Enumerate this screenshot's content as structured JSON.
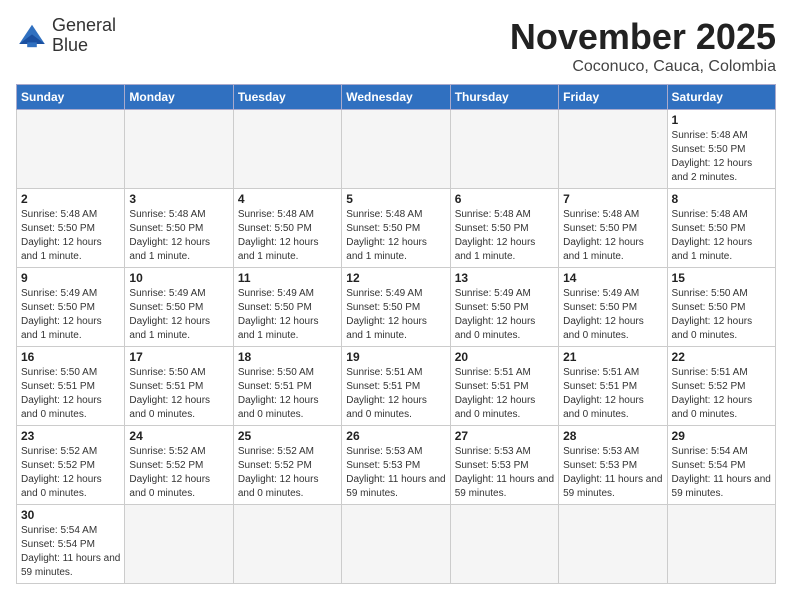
{
  "logo": {
    "line1": "General",
    "line2": "Blue"
  },
  "title": "November 2025",
  "location": "Coconuco, Cauca, Colombia",
  "days_of_week": [
    "Sunday",
    "Monday",
    "Tuesday",
    "Wednesday",
    "Thursday",
    "Friday",
    "Saturday"
  ],
  "weeks": [
    [
      {
        "day": "",
        "info": "",
        "empty": true
      },
      {
        "day": "",
        "info": "",
        "empty": true
      },
      {
        "day": "",
        "info": "",
        "empty": true
      },
      {
        "day": "",
        "info": "",
        "empty": true
      },
      {
        "day": "",
        "info": "",
        "empty": true
      },
      {
        "day": "",
        "info": "",
        "empty": true
      },
      {
        "day": "1",
        "info": "Sunrise: 5:48 AM\nSunset: 5:50 PM\nDaylight: 12 hours\nand 2 minutes."
      }
    ],
    [
      {
        "day": "2",
        "info": "Sunrise: 5:48 AM\nSunset: 5:50 PM\nDaylight: 12 hours\nand 1 minute."
      },
      {
        "day": "3",
        "info": "Sunrise: 5:48 AM\nSunset: 5:50 PM\nDaylight: 12 hours\nand 1 minute."
      },
      {
        "day": "4",
        "info": "Sunrise: 5:48 AM\nSunset: 5:50 PM\nDaylight: 12 hours\nand 1 minute."
      },
      {
        "day": "5",
        "info": "Sunrise: 5:48 AM\nSunset: 5:50 PM\nDaylight: 12 hours\nand 1 minute."
      },
      {
        "day": "6",
        "info": "Sunrise: 5:48 AM\nSunset: 5:50 PM\nDaylight: 12 hours\nand 1 minute."
      },
      {
        "day": "7",
        "info": "Sunrise: 5:48 AM\nSunset: 5:50 PM\nDaylight: 12 hours\nand 1 minute."
      },
      {
        "day": "8",
        "info": "Sunrise: 5:48 AM\nSunset: 5:50 PM\nDaylight: 12 hours\nand 1 minute."
      }
    ],
    [
      {
        "day": "9",
        "info": "Sunrise: 5:49 AM\nSunset: 5:50 PM\nDaylight: 12 hours\nand 1 minute."
      },
      {
        "day": "10",
        "info": "Sunrise: 5:49 AM\nSunset: 5:50 PM\nDaylight: 12 hours\nand 1 minute."
      },
      {
        "day": "11",
        "info": "Sunrise: 5:49 AM\nSunset: 5:50 PM\nDaylight: 12 hours\nand 1 minute."
      },
      {
        "day": "12",
        "info": "Sunrise: 5:49 AM\nSunset: 5:50 PM\nDaylight: 12 hours\nand 1 minute."
      },
      {
        "day": "13",
        "info": "Sunrise: 5:49 AM\nSunset: 5:50 PM\nDaylight: 12 hours\nand 0 minutes."
      },
      {
        "day": "14",
        "info": "Sunrise: 5:49 AM\nSunset: 5:50 PM\nDaylight: 12 hours\nand 0 minutes."
      },
      {
        "day": "15",
        "info": "Sunrise: 5:50 AM\nSunset: 5:50 PM\nDaylight: 12 hours\nand 0 minutes."
      }
    ],
    [
      {
        "day": "16",
        "info": "Sunrise: 5:50 AM\nSunset: 5:51 PM\nDaylight: 12 hours\nand 0 minutes."
      },
      {
        "day": "17",
        "info": "Sunrise: 5:50 AM\nSunset: 5:51 PM\nDaylight: 12 hours\nand 0 minutes."
      },
      {
        "day": "18",
        "info": "Sunrise: 5:50 AM\nSunset: 5:51 PM\nDaylight: 12 hours\nand 0 minutes."
      },
      {
        "day": "19",
        "info": "Sunrise: 5:51 AM\nSunset: 5:51 PM\nDaylight: 12 hours\nand 0 minutes."
      },
      {
        "day": "20",
        "info": "Sunrise: 5:51 AM\nSunset: 5:51 PM\nDaylight: 12 hours\nand 0 minutes."
      },
      {
        "day": "21",
        "info": "Sunrise: 5:51 AM\nSunset: 5:51 PM\nDaylight: 12 hours\nand 0 minutes."
      },
      {
        "day": "22",
        "info": "Sunrise: 5:51 AM\nSunset: 5:52 PM\nDaylight: 12 hours\nand 0 minutes."
      }
    ],
    [
      {
        "day": "23",
        "info": "Sunrise: 5:52 AM\nSunset: 5:52 PM\nDaylight: 12 hours\nand 0 minutes."
      },
      {
        "day": "24",
        "info": "Sunrise: 5:52 AM\nSunset: 5:52 PM\nDaylight: 12 hours\nand 0 minutes."
      },
      {
        "day": "25",
        "info": "Sunrise: 5:52 AM\nSunset: 5:52 PM\nDaylight: 12 hours\nand 0 minutes."
      },
      {
        "day": "26",
        "info": "Sunrise: 5:53 AM\nSunset: 5:53 PM\nDaylight: 11 hours\nand 59 minutes."
      },
      {
        "day": "27",
        "info": "Sunrise: 5:53 AM\nSunset: 5:53 PM\nDaylight: 11 hours\nand 59 minutes."
      },
      {
        "day": "28",
        "info": "Sunrise: 5:53 AM\nSunset: 5:53 PM\nDaylight: 11 hours\nand 59 minutes."
      },
      {
        "day": "29",
        "info": "Sunrise: 5:54 AM\nSunset: 5:54 PM\nDaylight: 11 hours\nand 59 minutes."
      }
    ],
    [
      {
        "day": "30",
        "info": "Sunrise: 5:54 AM\nSunset: 5:54 PM\nDaylight: 11 hours\nand 59 minutes."
      },
      {
        "day": "",
        "info": "",
        "empty": true
      },
      {
        "day": "",
        "info": "",
        "empty": true
      },
      {
        "day": "",
        "info": "",
        "empty": true
      },
      {
        "day": "",
        "info": "",
        "empty": true
      },
      {
        "day": "",
        "info": "",
        "empty": true
      },
      {
        "day": "",
        "info": "",
        "empty": true
      }
    ]
  ]
}
